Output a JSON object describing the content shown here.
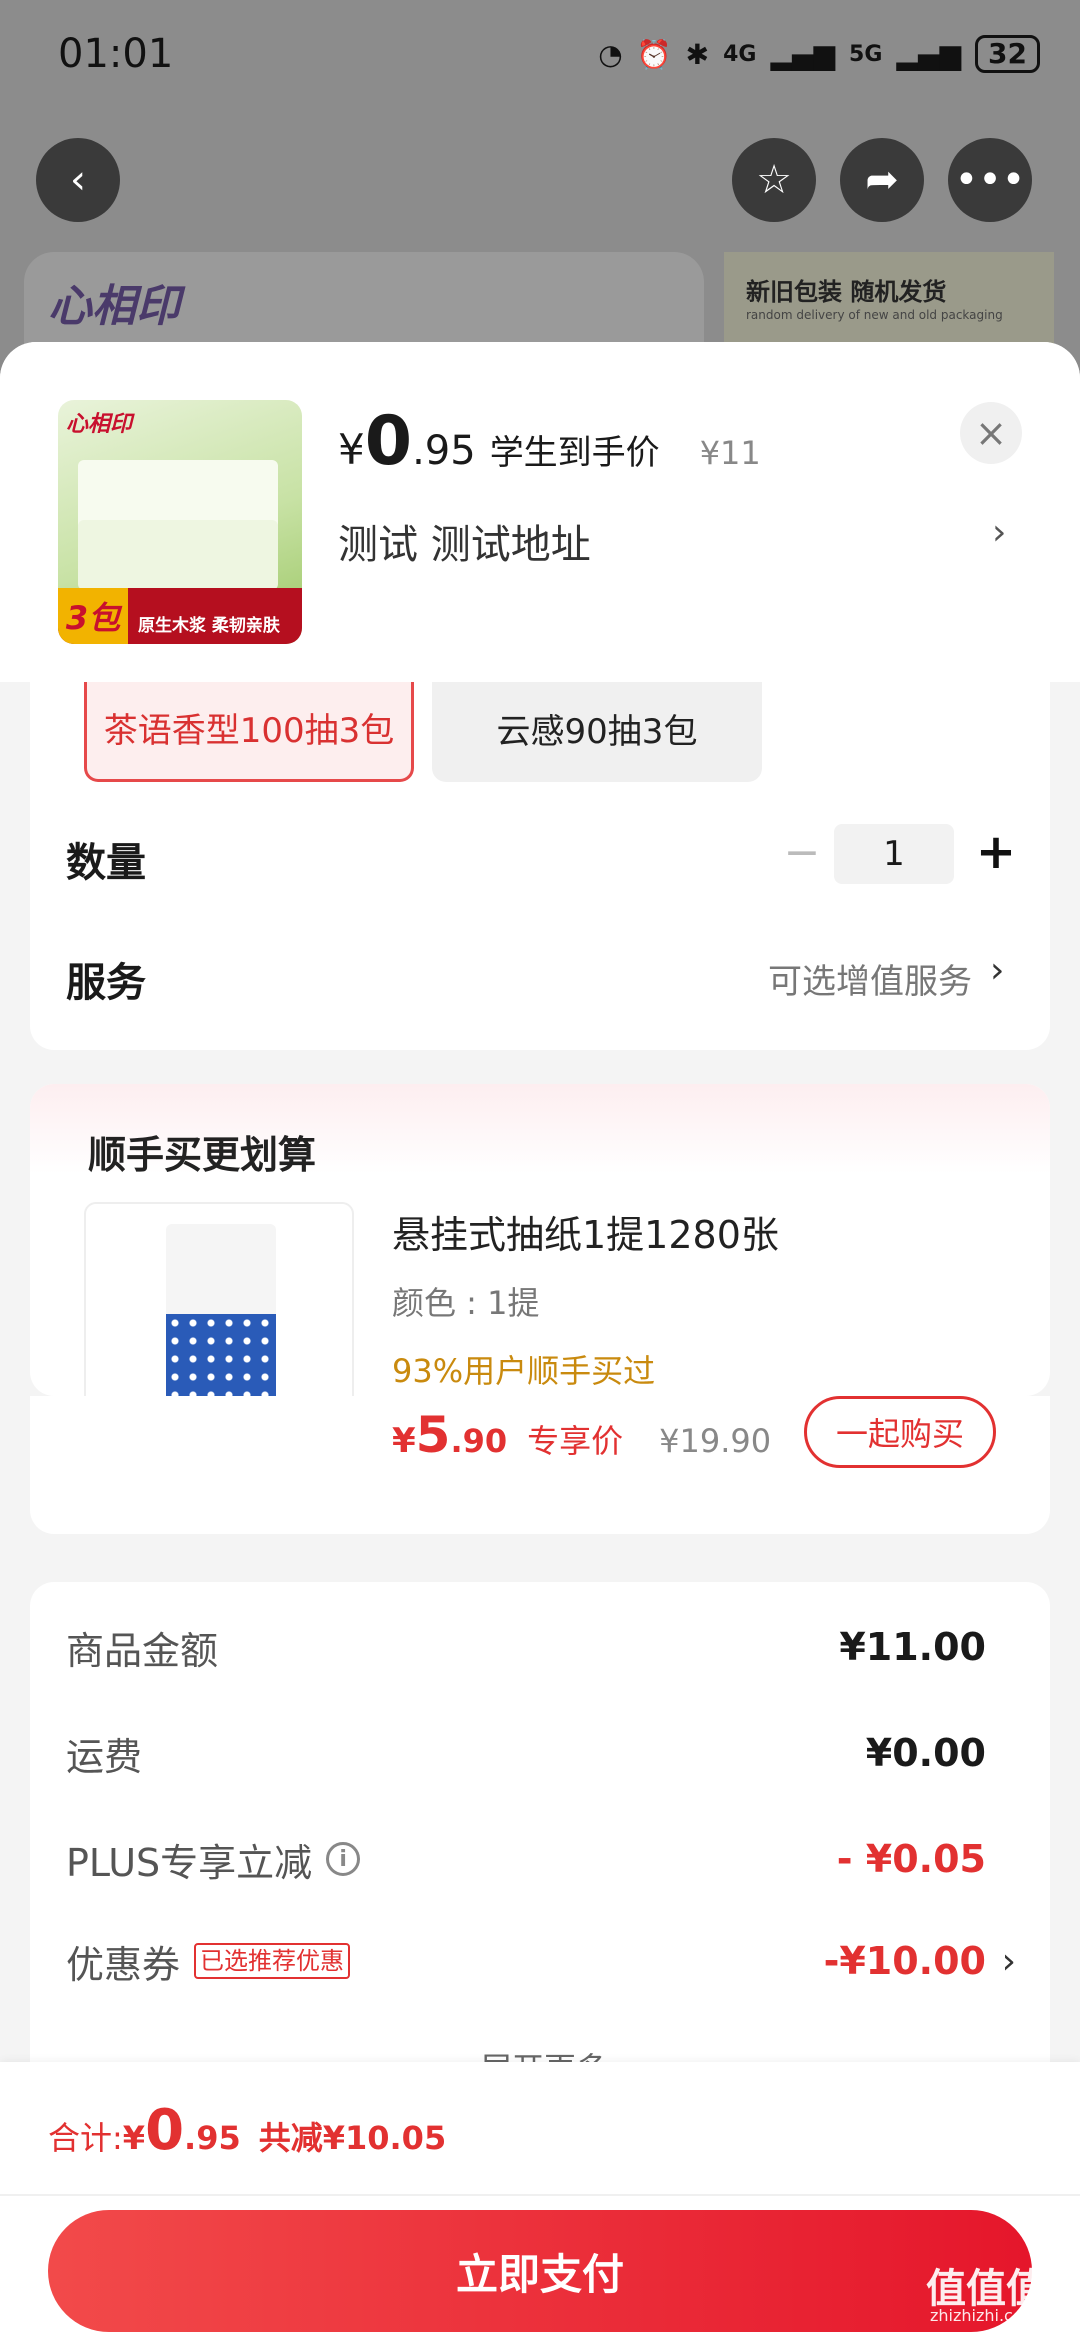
{
  "status_bar": {
    "time": "01:01",
    "signal_4g": "4G",
    "signal_5g": "5G",
    "battery": "32"
  },
  "background": {
    "brand_logo": "心相印",
    "banner_title": "新旧包装 随机发货",
    "banner_sub": "random delivery of new and old packaging"
  },
  "product": {
    "price_symbol": "¥",
    "price_int": "0",
    "price_dec": ".95",
    "price_label": "学生到手价",
    "original_price": "¥11",
    "address": "测试  测试地址",
    "thumb_logo": "心相印",
    "thumb_count": "3包",
    "thumb_tagline": "原生木浆 柔韧亲肤"
  },
  "specs": [
    {
      "label": "茶语香型100抽3包",
      "selected": true
    },
    {
      "label": "云感90抽3包",
      "selected": false
    }
  ],
  "quantity": {
    "label": "数量",
    "value": "1",
    "minus": "−",
    "plus": "+"
  },
  "service": {
    "label": "服务",
    "value": "可选增值服务"
  },
  "bundle": {
    "title": "顺手买更划算",
    "name": "悬挂式抽纸1提1280张",
    "color": "颜色 : 1提",
    "rate": "93%用户顺手买过",
    "price_symbol": "¥",
    "price_int": "5",
    "price_dec": ".90",
    "price_label": "专享价",
    "original_price": "¥19.90",
    "button": "一起购买"
  },
  "summary": {
    "goods_label": "商品金额",
    "goods_value": "¥11.00",
    "shipping_label": "运费",
    "shipping_value": "¥0.00",
    "plus_label": "PLUS专享立减",
    "plus_value": "- ¥0.05",
    "coupon_label": "优惠券",
    "coupon_tag": "已选推荐优惠",
    "coupon_value": "-¥10.00",
    "more": "展开更多"
  },
  "footer": {
    "total_label": "合计: ",
    "total_symbol": "¥",
    "total_int": "0",
    "total_dec": ".95",
    "total_save": "共减¥10.05",
    "pay_button": "立即支付"
  },
  "watermark": {
    "text": "值值值",
    "sub": "zhizhizhi.com"
  },
  "colors": {
    "accent": "#e23131",
    "gold": "#c98a0e"
  }
}
